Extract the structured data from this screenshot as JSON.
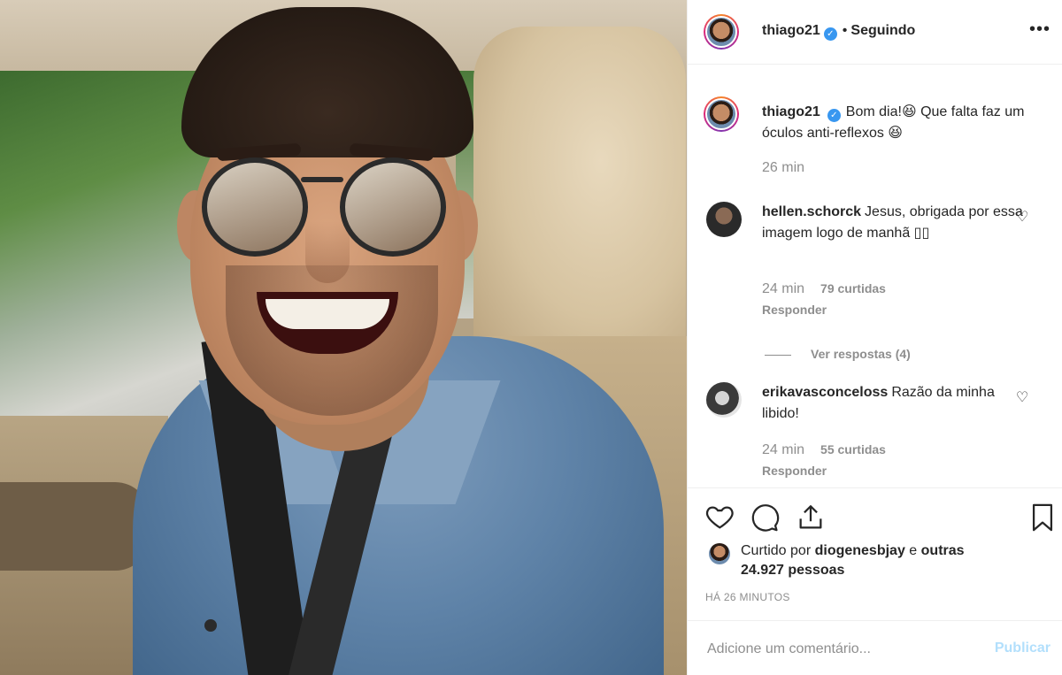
{
  "post": {
    "author": "thiago21",
    "follow_status": "Seguindo",
    "more_icon": "•••",
    "verified_icon": "✓"
  },
  "caption": {
    "username": "thiago21",
    "text": "Bom dia!😆 Que falta faz um óculos anti-reflexos 😆",
    "time": "26 min"
  },
  "comments": [
    {
      "username": "hellen.schorck",
      "text": "Jesus, obrigada por essa imagem logo de manhã ▯▯",
      "time": "24 min",
      "likes": "79 curtidas",
      "reply": "Responder",
      "heart_icon": "♡"
    },
    {
      "username": "erikavasconceloss",
      "text": "Razão da minha libido!",
      "time": "24 min",
      "likes": "55 curtidas",
      "reply": "Responder",
      "heart_icon": "♡"
    }
  ],
  "view_replies": "Ver respostas (4)",
  "likes_summary": {
    "prefix": "Curtido por ",
    "user": "diogenesbjay",
    "middle": " e ",
    "others": "outras 24.927 pessoas"
  },
  "posted_ago": "HÁ 26 MINUTOS",
  "comment_box": {
    "placeholder": "Adicione um comentário...",
    "publish_label": "Publicar"
  },
  "colors": {
    "accent_link": "#3897f0",
    "publish_disabled": "#b2dffc",
    "muted_text": "#8e8e8e"
  }
}
